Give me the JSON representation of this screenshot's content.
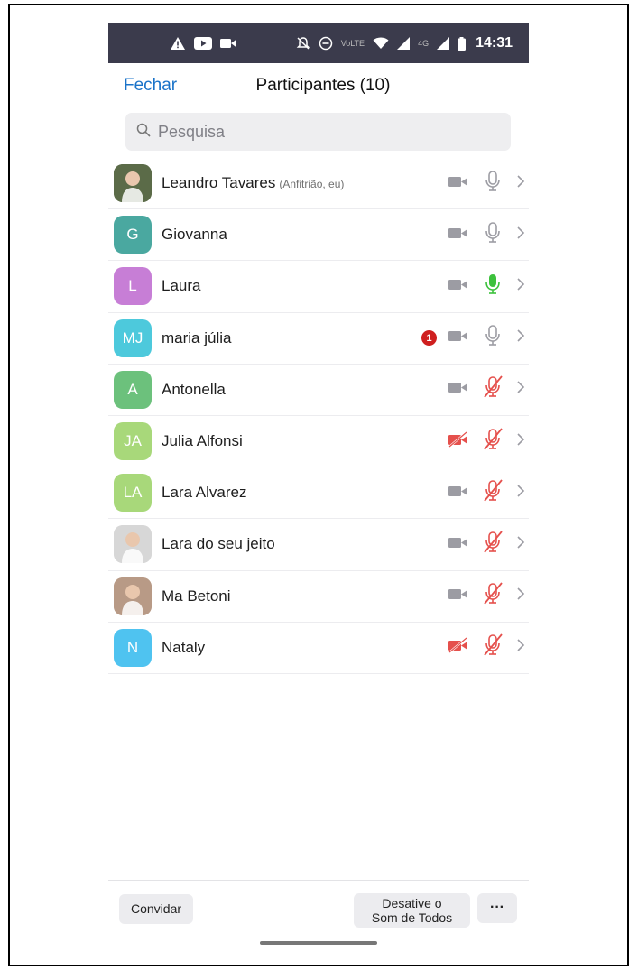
{
  "status_bar": {
    "time": "14:31",
    "left_icons": [
      "warning-icon",
      "youtube-icon",
      "video-camera-icon"
    ],
    "right_icons": [
      "bell-off-icon",
      "do-not-disturb-icon",
      "volte-icon",
      "wifi-icon",
      "signal-icon",
      "signal-4g-icon",
      "battery-icon"
    ],
    "volte_label": "VoLTE",
    "network_label": "4G"
  },
  "header": {
    "close_label": "Fechar",
    "title": "Participantes (10)"
  },
  "search": {
    "placeholder": "Pesquisa",
    "value": ""
  },
  "participants": [
    {
      "name": "Leandro Tavares",
      "tag": "(Anfitrião, eu)",
      "initials": "",
      "avatar_type": "photo",
      "avatar_color": "#5b6b48",
      "video": "on",
      "mic": "idle",
      "badge": ""
    },
    {
      "name": "Giovanna",
      "tag": "",
      "initials": "G",
      "avatar_type": "initials",
      "avatar_color": "#4aa8a0",
      "video": "on",
      "mic": "idle",
      "badge": ""
    },
    {
      "name": "Laura",
      "tag": "",
      "initials": "L",
      "avatar_type": "initials",
      "avatar_color": "#c77ed6",
      "video": "on",
      "mic": "speaking",
      "badge": ""
    },
    {
      "name": "maria júlia",
      "tag": "",
      "initials": "MJ",
      "avatar_type": "initials",
      "avatar_color": "#4dc9dc",
      "video": "on",
      "mic": "idle",
      "badge": "1"
    },
    {
      "name": "Antonella",
      "tag": "",
      "initials": "A",
      "avatar_type": "initials",
      "avatar_color": "#6cc17c",
      "video": "on",
      "mic": "muted",
      "badge": ""
    },
    {
      "name": "Julia Alfonsi",
      "tag": "",
      "initials": "JA",
      "avatar_type": "initials",
      "avatar_color": "#a8d87a",
      "video": "off",
      "mic": "muted",
      "badge": ""
    },
    {
      "name": "Lara Alvarez",
      "tag": "",
      "initials": "LA",
      "avatar_type": "initials",
      "avatar_color": "#a8d87a",
      "video": "on",
      "mic": "muted",
      "badge": ""
    },
    {
      "name": "Lara do seu jeito",
      "tag": "",
      "initials": "",
      "avatar_type": "photo",
      "avatar_color": "#d7d7d7",
      "video": "on",
      "mic": "muted",
      "badge": ""
    },
    {
      "name": "Ma Betoni",
      "tag": "",
      "initials": "",
      "avatar_type": "photo",
      "avatar_color": "#b89a86",
      "video": "on",
      "mic": "muted",
      "badge": ""
    },
    {
      "name": "Nataly",
      "tag": "",
      "initials": "N",
      "avatar_type": "initials",
      "avatar_color": "#4fc3f0",
      "video": "off",
      "mic": "muted",
      "badge": ""
    }
  ],
  "bottom": {
    "invite_label": "Convidar",
    "mute_all_line1": "Desative o",
    "mute_all_line2": "Som de Todos",
    "more_label": "···"
  },
  "colors": {
    "accent": "#1a73c9",
    "status_bar_bg": "#3b3b4c",
    "muted_red": "#e5504c",
    "speaking_green": "#3cc13c",
    "icon_gray": "#9c9ca3"
  }
}
